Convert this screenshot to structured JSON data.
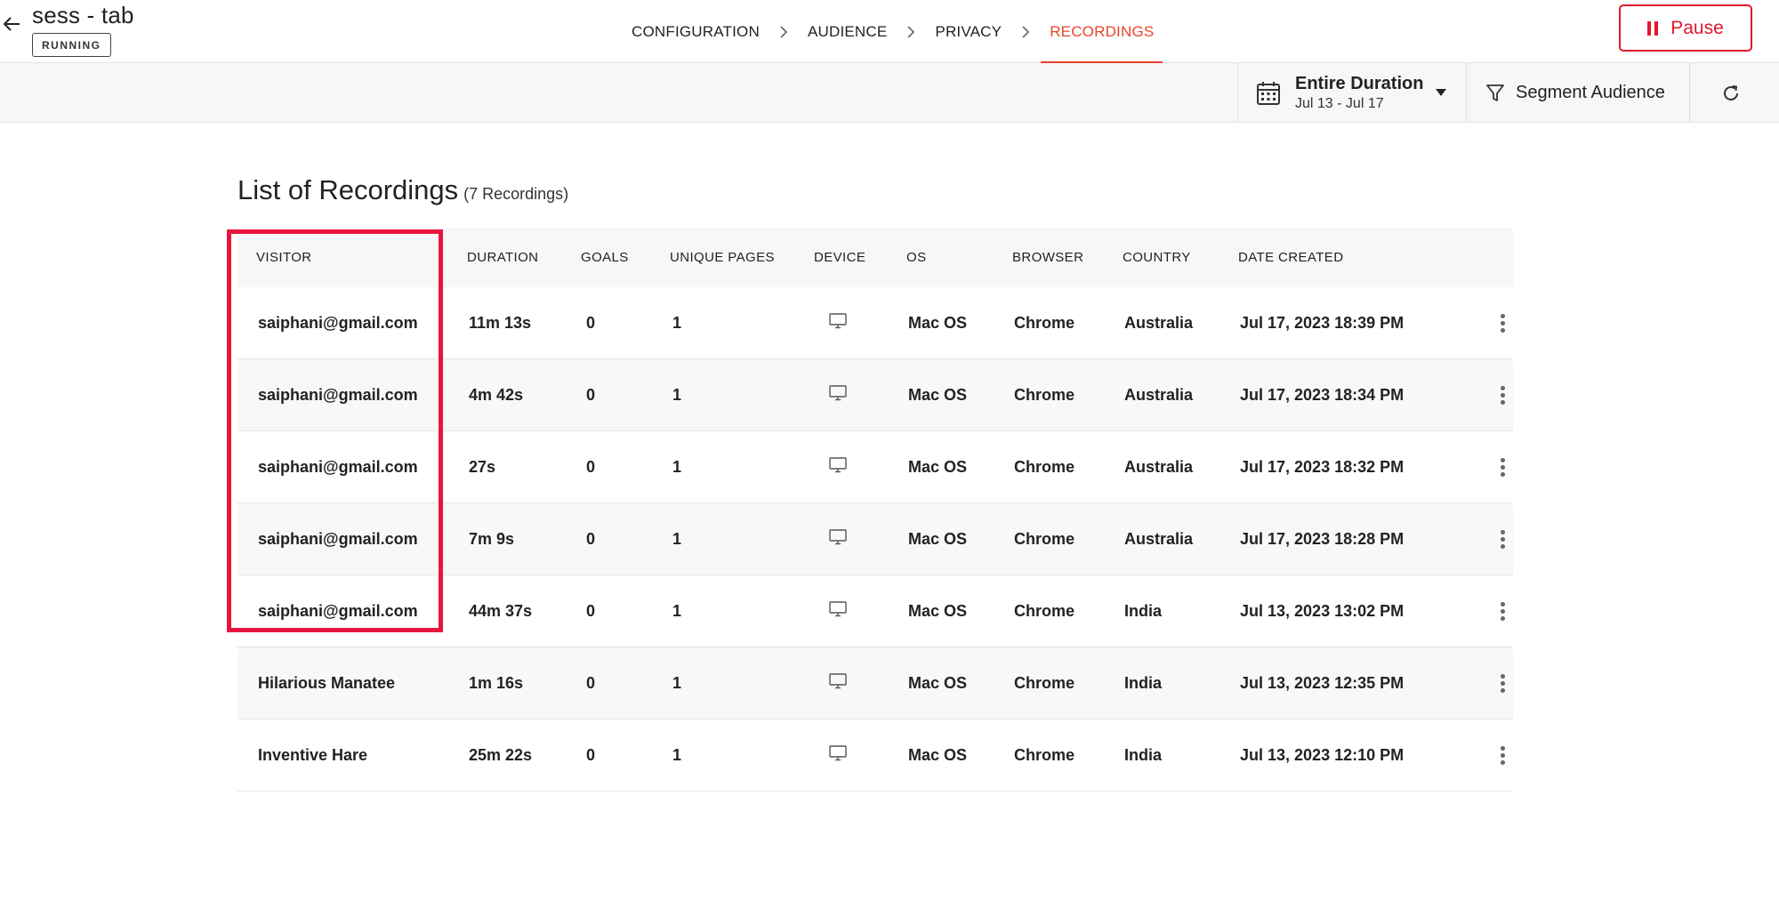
{
  "header": {
    "title": "sess - tab",
    "status": "RUNNING",
    "steps": [
      {
        "label": "CONFIGURATION",
        "active": false
      },
      {
        "label": "AUDIENCE",
        "active": false
      },
      {
        "label": "PRIVACY",
        "active": false
      },
      {
        "label": "RECORDINGS",
        "active": true
      }
    ],
    "pause_label": "Pause"
  },
  "toolbar": {
    "date_title": "Entire Duration",
    "date_range": "Jul 13 - Jul 17",
    "segment_label": "Segment Audience"
  },
  "main": {
    "title": "List of Recordings",
    "count": "(7 Recordings)",
    "columns": [
      "VISITOR",
      "DURATION",
      "GOALS",
      "UNIQUE PAGES",
      "DEVICE",
      "OS",
      "BROWSER",
      "COUNTRY",
      "DATE CREATED"
    ],
    "rows": [
      {
        "visitor": "saiphani@gmail.com",
        "duration": "11m 13s",
        "goals": "0",
        "pages": "1",
        "device": "desktop-icon",
        "os": "Mac OS",
        "browser": "Chrome",
        "country": "Australia",
        "date": "Jul 17, 2023 18:39 PM"
      },
      {
        "visitor": "saiphani@gmail.com",
        "duration": "4m 42s",
        "goals": "0",
        "pages": "1",
        "device": "desktop-icon",
        "os": "Mac OS",
        "browser": "Chrome",
        "country": "Australia",
        "date": "Jul 17, 2023 18:34 PM"
      },
      {
        "visitor": "saiphani@gmail.com",
        "duration": "27s",
        "goals": "0",
        "pages": "1",
        "device": "desktop-icon",
        "os": "Mac OS",
        "browser": "Chrome",
        "country": "Australia",
        "date": "Jul 17, 2023 18:32 PM"
      },
      {
        "visitor": "saiphani@gmail.com",
        "duration": "7m 9s",
        "goals": "0",
        "pages": "1",
        "device": "desktop-icon",
        "os": "Mac OS",
        "browser": "Chrome",
        "country": "Australia",
        "date": "Jul 17, 2023 18:28 PM"
      },
      {
        "visitor": "saiphani@gmail.com",
        "duration": "44m 37s",
        "goals": "0",
        "pages": "1",
        "device": "desktop-icon",
        "os": "Mac OS",
        "browser": "Chrome",
        "country": "India",
        "date": "Jul 13, 2023 13:02 PM"
      },
      {
        "visitor": "Hilarious Manatee",
        "duration": "1m 16s",
        "goals": "0",
        "pages": "1",
        "device": "desktop-icon",
        "os": "Mac OS",
        "browser": "Chrome",
        "country": "India",
        "date": "Jul 13, 2023 12:35 PM"
      },
      {
        "visitor": "Inventive Hare",
        "duration": "25m 22s",
        "goals": "0",
        "pages": "1",
        "device": "desktop-icon",
        "os": "Mac OS",
        "browser": "Chrome",
        "country": "India",
        "date": "Jul 13, 2023 12:10 PM"
      }
    ]
  },
  "colors": {
    "accent": "#e8452c",
    "pause": "#e0182d",
    "highlight": "#e8163f"
  }
}
